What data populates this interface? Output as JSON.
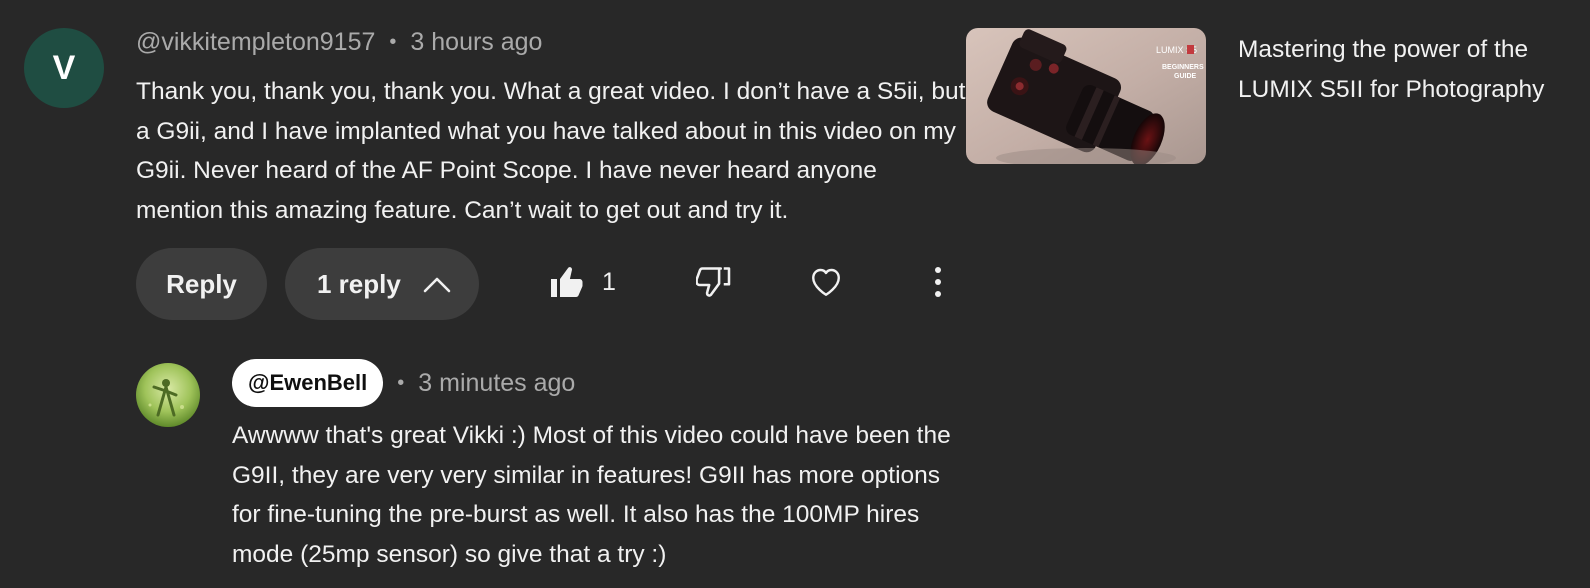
{
  "comment": {
    "avatar_letter": "V",
    "author": "@vikkitempleton9157",
    "separator": "•",
    "time": "3 hours ago",
    "text": "Thank you, thank you, thank you. What a great video. I don’t have a S5ii, but a G9ii, and I have implanted what you have talked about in this video on my G9ii. Never heard of the AF Point Scope. I have never heard anyone mention this amazing feature. Can’t wait to get out and try it.",
    "avatar_color": "#1f4d42"
  },
  "actions": {
    "reply_label": "Reply",
    "replies_label": "1 reply",
    "like_count": "1",
    "icons": [
      "chevron-up-icon",
      "thumbs-up-icon",
      "thumbs-down-icon",
      "heart-icon",
      "more-vert-icon"
    ]
  },
  "reply": {
    "author": "@EwenBell",
    "separator": "•",
    "time": "3 minutes ago",
    "text": "Awwww that's great Vikki :) Most of this video could have been the G9II, they are very very similar in features! G9II has more options for fine-tuning the pre-burst as well. It also has the 100MP hires mode (25mp sensor) so give that a try :)"
  },
  "video": {
    "title": "Mastering the power of the LUMIX S5II for Photography",
    "thumbnail_brand": "LUMIX S5",
    "thumbnail_caption_line1": "BEGINNERS",
    "thumbnail_caption_line2": "GUIDE"
  }
}
